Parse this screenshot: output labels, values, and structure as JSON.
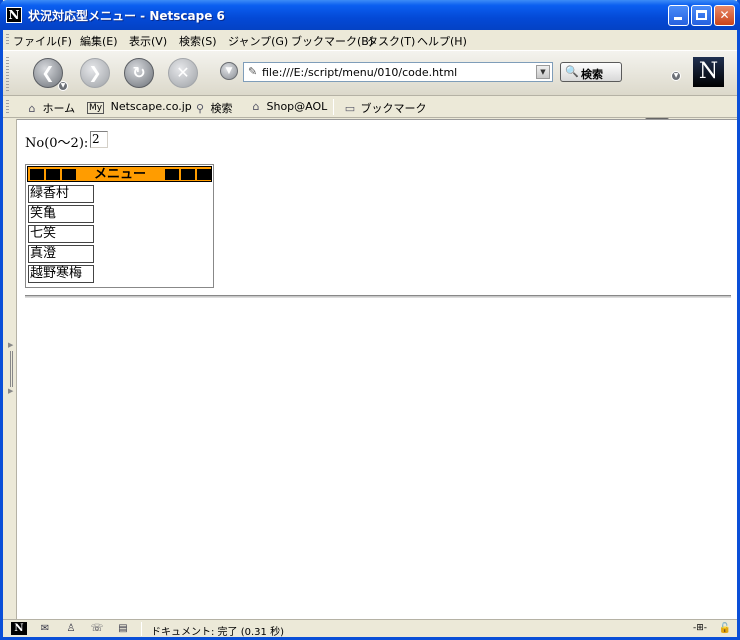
{
  "window": {
    "title": "状況対応型メニュー - Netscape 6",
    "app_icon": "N",
    "controls": [
      "minimize",
      "maximize",
      "close"
    ]
  },
  "menubar": {
    "items": [
      "ファイル(F)",
      "編集(E)",
      "表示(V)",
      "検索(S)",
      "ジャンプ(G)",
      "ブックマーク(B)",
      "タスク(T)",
      "ヘルプ(H)"
    ]
  },
  "navbar": {
    "back_icon": "back-arrow-icon",
    "forward_icon": "forward-arrow-icon",
    "reload_icon": "reload-icon",
    "stop_icon": "stop-icon",
    "url": "file:///E:/script/menu/010/code.html",
    "search_label": "検索",
    "logo": "N"
  },
  "personalbar": {
    "home": "ホーム",
    "my_label": "My",
    "netscape": "Netscape.co.jp",
    "search": "検索",
    "shop": "Shop@AOL",
    "bookmarks": "ブックマーク"
  },
  "page": {
    "no_label": "No(0〜2):",
    "no_value": "2",
    "menu_title": "メニュー",
    "menu_items": [
      "緑香村",
      "笑亀",
      "七笑",
      "真澄",
      "越野寒梅"
    ]
  },
  "statusbar": {
    "text": "ドキュメント: 完了 (0.31 秒)"
  }
}
